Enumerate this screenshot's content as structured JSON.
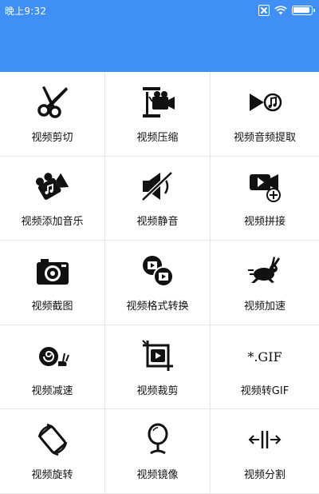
{
  "status_bar": {
    "time": "晚上9:32"
  },
  "tools": [
    {
      "label": "视频剪切",
      "icon": "scissors-icon"
    },
    {
      "label": "视频压缩",
      "icon": "compress-camera-icon"
    },
    {
      "label": "视频音频提取",
      "icon": "play-music-icon"
    },
    {
      "label": "视频添加音乐",
      "icon": "camera-music-icon"
    },
    {
      "label": "视频静音",
      "icon": "mute-icon"
    },
    {
      "label": "视频拼接",
      "icon": "video-add-icon"
    },
    {
      "label": "视频截图",
      "icon": "camera-icon"
    },
    {
      "label": "视频格式转换",
      "icon": "convert-icon"
    },
    {
      "label": "视频加速",
      "icon": "rabbit-icon"
    },
    {
      "label": "视频减速",
      "icon": "snail-icon"
    },
    {
      "label": "视频裁剪",
      "icon": "crop-icon"
    },
    {
      "label": "视频转GIF",
      "icon": "gif-icon",
      "icon_text": "*.GIF"
    },
    {
      "label": "视频旋转",
      "icon": "rotate-icon"
    },
    {
      "label": "视频镜像",
      "icon": "mirror-icon"
    },
    {
      "label": "视频分割",
      "icon": "split-icon"
    }
  ]
}
